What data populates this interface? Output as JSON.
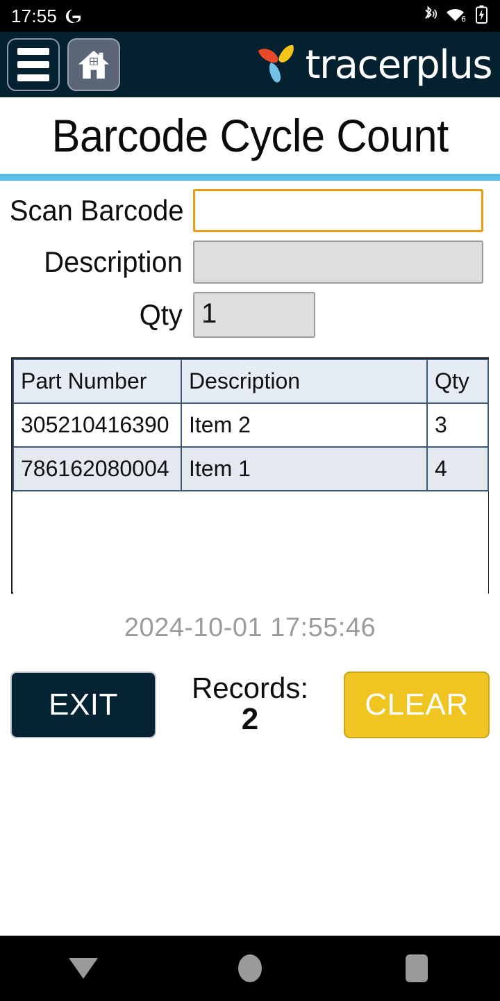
{
  "statusbar": {
    "time": "17:55",
    "google_icon": "google-g-icon",
    "bluetooth_icon": "bluetooth-audio-icon",
    "wifi_icon": "wifi-6-icon",
    "wifi_generation": "6",
    "battery_icon": "battery-charging-icon"
  },
  "header": {
    "menu_icon": "hamburger-menu-icon",
    "home_icon": "home-icon",
    "logo_mark": "tracerplus-pinwheel-logo",
    "logo_text": "tracerplus",
    "bg_color": "#04212f",
    "logo_red": "#e8492a",
    "logo_yellow": "#f5c518",
    "logo_blue": "#72c2e8"
  },
  "page": {
    "title": "Barcode Cycle Count",
    "accent_color": "#5bbfe9"
  },
  "form": {
    "fields": [
      {
        "label": "Scan Barcode",
        "value": "",
        "placeholder": "",
        "state": "focused",
        "border_color": "#e59b12"
      },
      {
        "label": "Description",
        "value": "",
        "placeholder": "",
        "state": "readonly",
        "bg_color": "#dedede"
      },
      {
        "label": "Qty",
        "value": "1",
        "placeholder": "",
        "state": "readonly",
        "bg_color": "#dedede"
      }
    ]
  },
  "table": {
    "columns": [
      "Part Number",
      "Description",
      "Qty"
    ],
    "rows": [
      {
        "part_number": "305210416390",
        "description": "Item 2",
        "qty": "3"
      },
      {
        "part_number": "786162080004",
        "description": "Item 1",
        "qty": "4"
      }
    ],
    "header_bg": "#e6ecf4",
    "alt_row_bg": "#e3e9ef"
  },
  "status": {
    "timestamp": "2024-10-01 17:55:46"
  },
  "actions": {
    "exit_label": "EXIT",
    "exit_color": "#042333",
    "records_label": "Records:",
    "records_count": "2",
    "clear_label": "CLEAR",
    "clear_color": "#f0c522"
  },
  "navbar": {
    "back_icon": "back-triangle-icon",
    "home_icon": "home-circle-icon",
    "recents_icon": "recents-square-icon"
  }
}
